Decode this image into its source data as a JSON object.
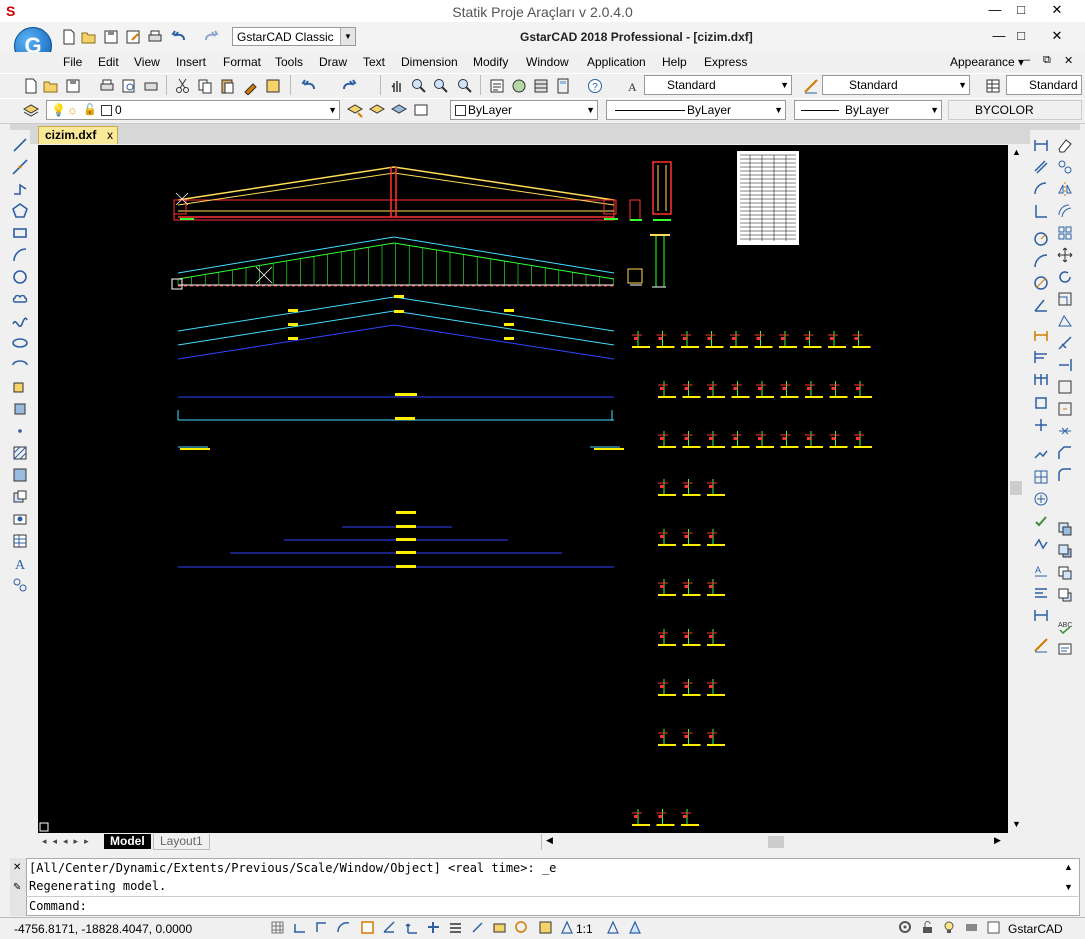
{
  "window": {
    "outer_title": "Statik Proje Araçları v 2.0.4.0",
    "app_title": "GstarCAD 2018 Professional - [cizim.dxf]",
    "app_letter": "S",
    "logo_letter": "G",
    "minimize": "—",
    "maximize": "□",
    "close": "✕"
  },
  "quick_access": {
    "workspace": "GstarCAD Classic"
  },
  "menu": {
    "items": [
      "File",
      "Edit",
      "View",
      "Insert",
      "Format",
      "Tools",
      "Draw",
      "Text",
      "Dimension",
      "Modify",
      "Window",
      "Application",
      "Help",
      "Express"
    ],
    "appearance": "Appearance"
  },
  "styles_toolbar": {
    "text_style": "Standard",
    "dim_style": "Standard",
    "table_style": "Standard"
  },
  "layers_toolbar": {
    "current_layer": "0",
    "color": "ByLayer",
    "linetype": "ByLayer",
    "lineweight": "ByLayer",
    "plotstyle": "BYCOLOR"
  },
  "document": {
    "tab_label": "cizim.dxf",
    "tab_close": "x"
  },
  "layout_tabs": [
    "Model",
    "Layout1"
  ],
  "command": {
    "history": [
      "[All/Center/Dynamic/Extents/Previous/Scale/Window/Object] <real time>: _e",
      "Regenerating model."
    ],
    "prompt": "Command:"
  },
  "status": {
    "coordinates": "-4756.8171, -18828.4047, 0.0000",
    "scale": "1:1",
    "product": "GstarCAD"
  },
  "colors": {
    "canvas": "#000000",
    "tab_active": "#fbe99a"
  }
}
